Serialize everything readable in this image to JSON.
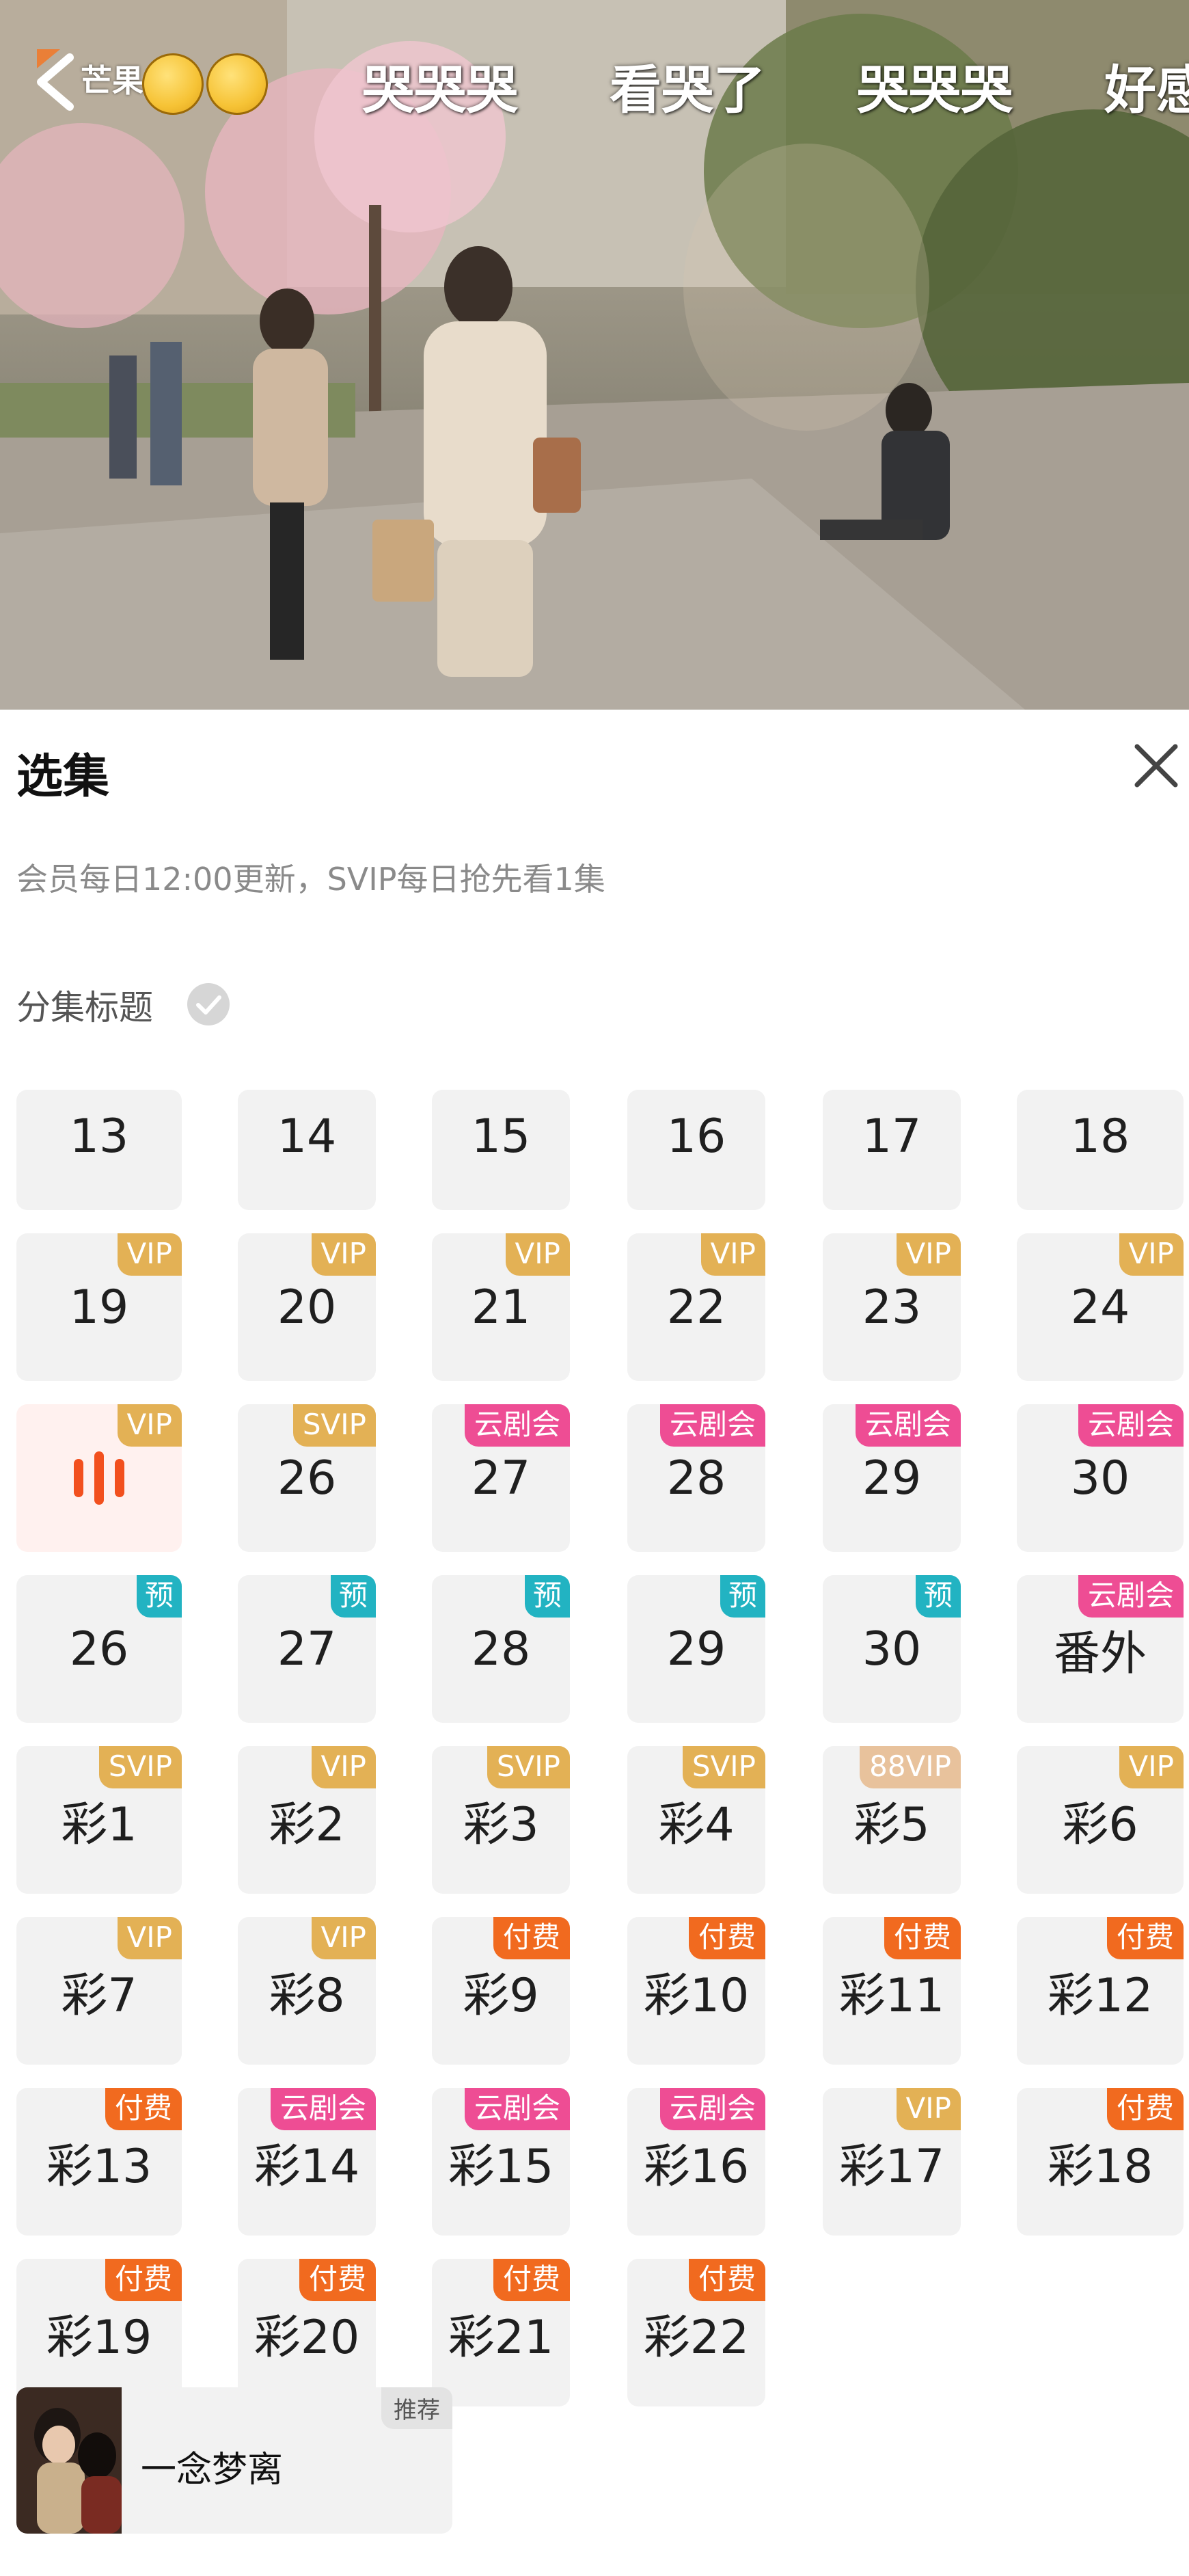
{
  "player": {
    "danmaku": [
      "哭哭哭",
      "看哭了",
      "哭哭哭",
      "好感"
    ],
    "logo_text": "芒果",
    "emoji": [
      "pleading-face",
      "pleading-face"
    ]
  },
  "panel": {
    "title": "选集",
    "notice": "会员每日12:00更新，SVIP每日抢先看1集",
    "episode_title_toggle": "分集标题"
  },
  "episodes": [
    {
      "label": "13",
      "badge": ""
    },
    {
      "label": "14",
      "badge": ""
    },
    {
      "label": "15",
      "badge": ""
    },
    {
      "label": "16",
      "badge": ""
    },
    {
      "label": "17",
      "badge": ""
    },
    {
      "label": "18",
      "badge": ""
    },
    {
      "label": "19",
      "badge": "VIP"
    },
    {
      "label": "20",
      "badge": "VIP"
    },
    {
      "label": "21",
      "badge": "VIP"
    },
    {
      "label": "22",
      "badge": "VIP"
    },
    {
      "label": "23",
      "badge": "VIP"
    },
    {
      "label": "24",
      "badge": "VIP"
    },
    {
      "label": "",
      "badge": "VIP",
      "playing": true
    },
    {
      "label": "26",
      "badge": "SVIP"
    },
    {
      "label": "27",
      "badge": "云剧会"
    },
    {
      "label": "28",
      "badge": "云剧会"
    },
    {
      "label": "29",
      "badge": "云剧会"
    },
    {
      "label": "30",
      "badge": "云剧会"
    },
    {
      "label": "26",
      "badge": "预"
    },
    {
      "label": "27",
      "badge": "预"
    },
    {
      "label": "28",
      "badge": "预"
    },
    {
      "label": "29",
      "badge": "预"
    },
    {
      "label": "30",
      "badge": "预"
    },
    {
      "label": "番外",
      "badge": "云剧会"
    },
    {
      "label": "彩1",
      "badge": "SVIP"
    },
    {
      "label": "彩2",
      "badge": "VIP"
    },
    {
      "label": "彩3",
      "badge": "SVIP"
    },
    {
      "label": "彩4",
      "badge": "SVIP"
    },
    {
      "label": "彩5",
      "badge": "88VIP"
    },
    {
      "label": "彩6",
      "badge": "VIP"
    },
    {
      "label": "彩7",
      "badge": "VIP"
    },
    {
      "label": "彩8",
      "badge": "VIP"
    },
    {
      "label": "彩9",
      "badge": "付费"
    },
    {
      "label": "彩10",
      "badge": "付费"
    },
    {
      "label": "彩11",
      "badge": "付费"
    },
    {
      "label": "彩12",
      "badge": "付费"
    },
    {
      "label": "彩13",
      "badge": "付费"
    },
    {
      "label": "彩14",
      "badge": "云剧会"
    },
    {
      "label": "彩15",
      "badge": "云剧会"
    },
    {
      "label": "彩16",
      "badge": "云剧会"
    },
    {
      "label": "彩17",
      "badge": "VIP"
    },
    {
      "label": "彩18",
      "badge": "付费"
    },
    {
      "label": "彩19",
      "badge": "付费"
    },
    {
      "label": "彩20",
      "badge": "付费"
    },
    {
      "label": "彩21",
      "badge": "付费"
    },
    {
      "label": "彩22",
      "badge": "付费"
    }
  ],
  "recommendation": {
    "title": "一念梦离",
    "tag": "推荐"
  },
  "colors": {
    "vip": "#e3b155",
    "cloud": "#ee4d94",
    "preview": "#22b3c2",
    "vip88": "#e8c29c",
    "paid": "#f16a1f",
    "playing": "#f2501e"
  }
}
